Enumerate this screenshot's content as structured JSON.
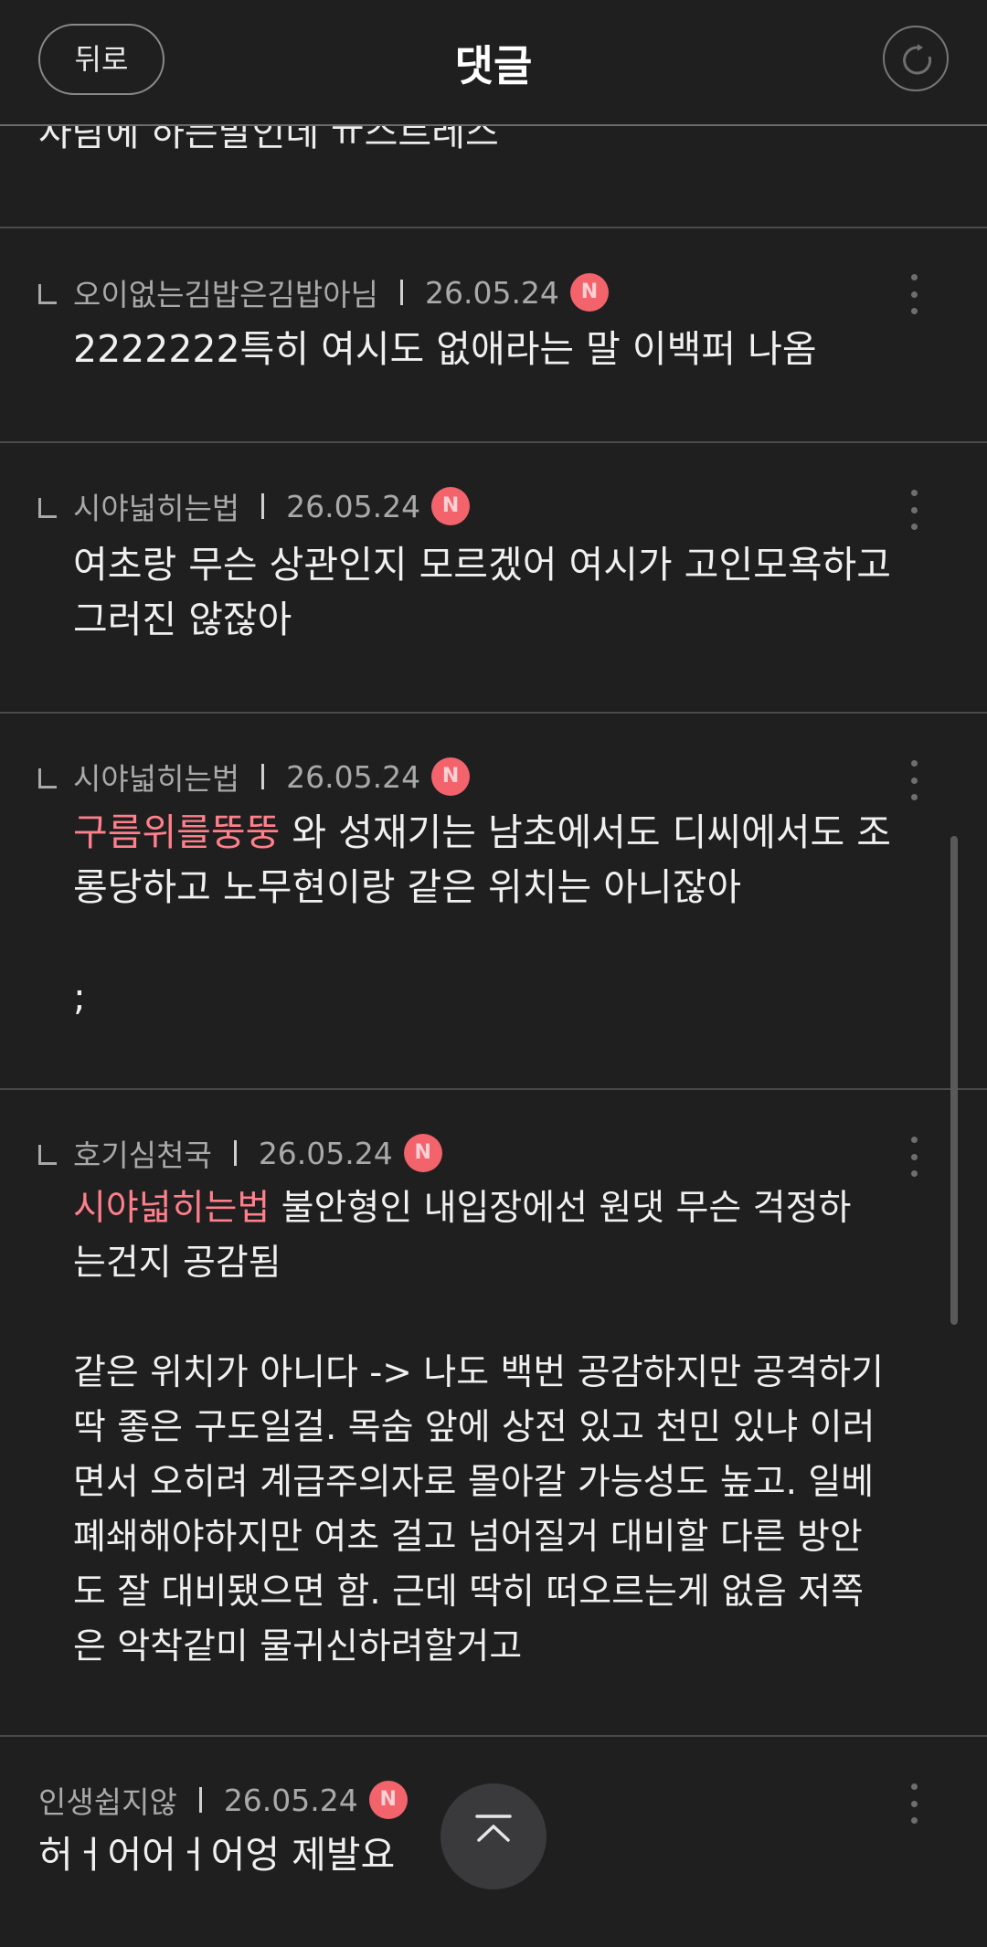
{
  "header": {
    "back_label": "뒤로",
    "title": "댓글"
  },
  "partial_top_text": "사람에 하는말인데 ㅠ스트레스",
  "comments": [
    {
      "author": "오이없는김밥은김밥아님",
      "date": "26.05.24",
      "badge": "N",
      "mention": "",
      "text": "2222222특히 여시도 없애라는 말 이백퍼 나옴"
    },
    {
      "author": "시야넓히는법",
      "date": "26.05.24",
      "badge": "N",
      "mention": "",
      "text": "여초랑 무슨 상관인지 모르겠어 여시가 고인모욕하고\n그러진 않잖아"
    },
    {
      "author": "시야넓히는법",
      "date": "26.05.24",
      "badge": "N",
      "mention": "구름위를뚱뚱",
      "text": " 와 성재기는 남초에서도 디씨에서도 조\n롱당하고 노무현이랑 같은 위치는 아니잖아\n\n;"
    },
    {
      "author": "호기심천국",
      "date": "26.05.24",
      "badge": "N",
      "mention": "시야넓히는법",
      "text": " 불안형인 내입장에선 원댓 무슨 걱정하\n는건지 공감됨\n\n같은 위치가 아니다 -> 나도 백번 공감하지만 공격하기\n딱 좋은 구도일걸. 목숨 앞에 상전 있고 천민 있냐 이러\n면서 오히려 계급주의자로 몰아갈 가능성도 높고. 일베\n폐쇄해야하지만 여초 걸고 넘어질거 대비할 다른 방안\n도 잘 대비됐으면 함. 근데 딱히 떠오르는게 없음 저쪽\n은 악착같미 물귀신하려할거고"
    },
    {
      "author": "인생쉽지않",
      "date": "26.05.24",
      "badge": "N",
      "mention": "",
      "text": "허ㅓ어어ㅓ어엉 제발요"
    }
  ],
  "icons": {
    "refresh": "refresh-icon",
    "more": "more-vertical-icon",
    "scroll_top": "chevron-up-icon"
  },
  "colors": {
    "background": "#1f1f20",
    "mention": "#ff7f8a",
    "badge": "#f2636c"
  }
}
